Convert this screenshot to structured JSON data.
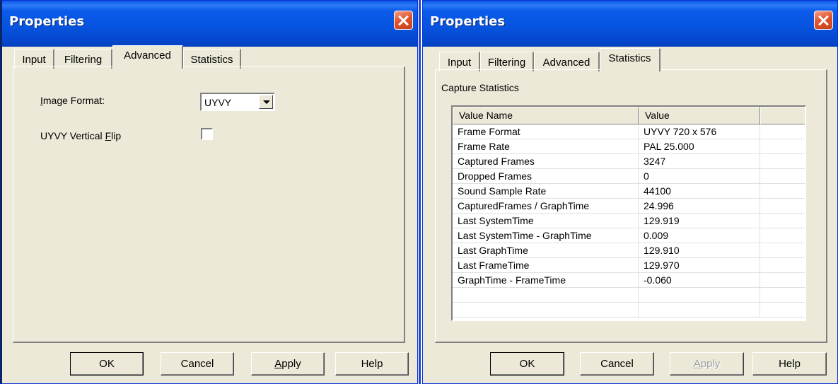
{
  "dialog_left": {
    "title": "Properties",
    "tabs": [
      "Input",
      "Filtering",
      "Advanced",
      "Statistics"
    ],
    "active_tab": "Advanced",
    "image_format_label": "Image Format:",
    "image_format_value": "UYVY",
    "vertical_flip_label": "UYVY Vertical Flip",
    "vertical_flip_checked": false,
    "buttons": {
      "ok": "OK",
      "cancel": "Cancel",
      "apply": "Apply",
      "help": "Help"
    }
  },
  "dialog_right": {
    "title": "Properties",
    "tabs": [
      "Input",
      "Filtering",
      "Advanced",
      "Statistics"
    ],
    "active_tab": "Statistics",
    "group_label": "Capture Statistics",
    "columns": [
      "Value Name",
      "Value"
    ],
    "rows": [
      [
        "Frame Format",
        "UYVY   720 x 576"
      ],
      [
        "Frame Rate",
        "PAL  25.000"
      ],
      [
        "Captured Frames",
        "3247"
      ],
      [
        "Dropped Frames",
        "0"
      ],
      [
        "Sound Sample Rate",
        "44100"
      ],
      [
        "CapturedFrames / GraphTime",
        "24.996"
      ],
      [
        "Last SystemTime",
        "129.919"
      ],
      [
        "Last SystemTime - GraphTime",
        "0.009"
      ],
      [
        "Last GraphTime",
        "129.910"
      ],
      [
        "Last FrameTime",
        "129.970"
      ],
      [
        "GraphTime - FrameTime",
        "-0.060"
      ]
    ],
    "buttons": {
      "ok": "OK",
      "cancel": "Cancel",
      "apply": "Apply",
      "help": "Help"
    },
    "apply_disabled": true
  },
  "colors": {
    "titlebar": "#0654e0",
    "face": "#ece9d8",
    "close": "#e0552f"
  }
}
